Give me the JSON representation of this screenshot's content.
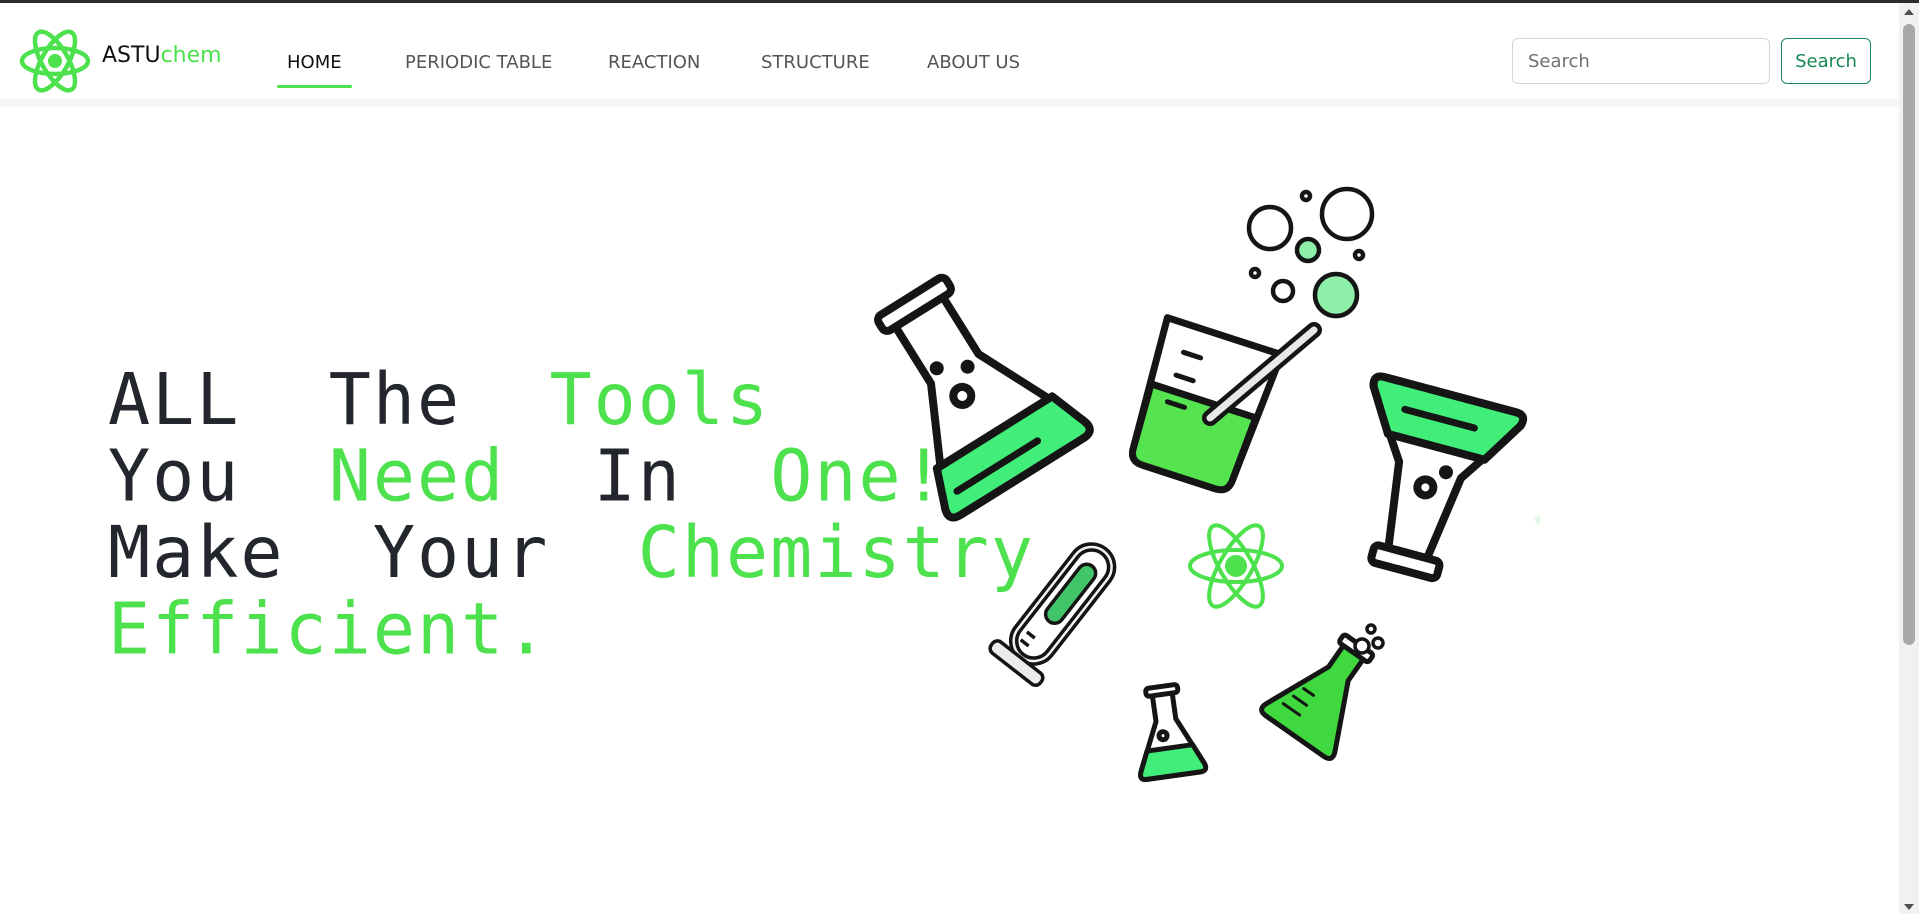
{
  "brand": {
    "name_part1": "ASTU",
    "name_part2": "chem",
    "logo_icon": "atom-icon"
  },
  "nav": {
    "items": [
      {
        "label": "HOME",
        "active": true
      },
      {
        "label": "PERIODIC TABLE",
        "active": false
      },
      {
        "label": "REACTION",
        "active": false
      },
      {
        "label": "STRUCTURE",
        "active": false
      },
      {
        "label": "ABOUT US",
        "active": false
      }
    ]
  },
  "search": {
    "placeholder": "Search",
    "value": "",
    "button_label": "Search"
  },
  "hero": {
    "line1": {
      "w1": "ALL",
      "w2": "The",
      "w3": "Tools"
    },
    "line2": {
      "w1": "You",
      "w2": "Need",
      "w3": "In",
      "w4": "One!"
    },
    "line3": {
      "w1": "Make",
      "w2": "Your",
      "w3": "Chemistry"
    },
    "line4": {
      "w1": "Efficient."
    }
  },
  "illustration": {
    "icons": [
      "erlenmeyer-flask-icon",
      "beaker-icon",
      "bubbles-icon",
      "round-flask-icon",
      "test-tube-icon",
      "atom-icon",
      "small-flask-icon",
      "tilted-flask-icon",
      "molecule-icon"
    ]
  },
  "colors": {
    "accent": "#4de24d",
    "text_dark": "#23262d",
    "button_border": "#198754"
  }
}
